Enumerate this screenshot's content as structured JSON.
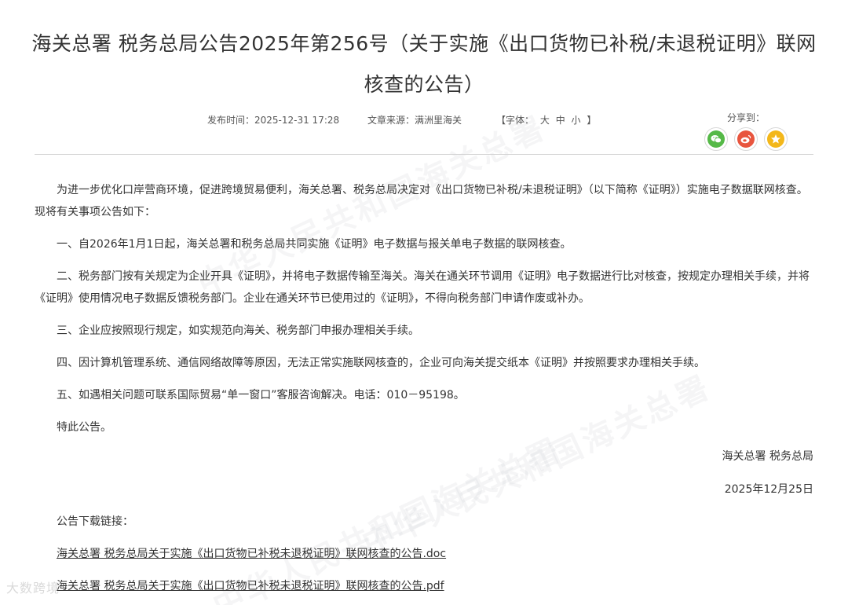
{
  "article": {
    "title": "海关总署 税务总局公告2025年第256号（关于实施《出口货物已补税/未退税证明》联网核查的公告）",
    "meta": {
      "date": "发布时间：2025-12-31 17:28",
      "source": "文章来源：满洲里海关",
      "font_label_open": "【字体：",
      "font_large": "大",
      "font_medium": "中",
      "font_small": "小",
      "font_label_close": "】"
    },
    "share": {
      "label": "分享到：",
      "icons": [
        "wechat-icon",
        "weibo-icon",
        "qzone-icon"
      ]
    },
    "paragraphs": [
      "为进一步优化口岸营商环境，促进跨境贸易便利，海关总署、税务总局决定对《出口货物已补税/未退税证明》（以下简称《证明》）实施电子数据联网核查。现将有关事项公告如下：",
      "一、自2026年1月1日起，海关总署和税务总局共同实施《证明》电子数据与报关单电子数据的联网核查。",
      "二、税务部门按有关规定为企业开具《证明》，并将电子数据传输至海关。海关在通关环节调用《证明》电子数据进行比对核查，按规定办理相关手续，并将《证明》使用情况电子数据反馈税务部门。企业在通关环节已使用过的《证明》，不得向税务部门申请作废或补办。",
      "三、企业应按照现行规定，如实规范向海关、税务部门申报办理相关手续。",
      "四、因计算机管理系统、通信网络故障等原因，无法正常实施联网核查的，企业可向海关提交纸本《证明》并按照要求办理相关手续。",
      "五、如遇相关问题可联系国际贸易“单一窗口”客服咨询解决。电话：010－95198。",
      "特此公告。"
    ],
    "signer": "海关总署 税务总局",
    "sign_date": "2025年12月25日",
    "download_label": "公告下载链接：",
    "download_links": [
      "海关总署 税务总局关于实施《出口货物已补税未退税证明》联网核查的公告.doc",
      "海关总署 税务总局关于实施《出口货物已补税未退税证明》联网核查的公告.pdf"
    ]
  },
  "watermark": "中华人民共和国海关总署",
  "corner_logo": "大数跨境",
  "colors": {
    "text": "#333333",
    "meta": "#555555",
    "divider": "#d4d4d4",
    "wechat": "#55b947",
    "weibo": "#e8553e",
    "qzone": "#f3b71a"
  }
}
